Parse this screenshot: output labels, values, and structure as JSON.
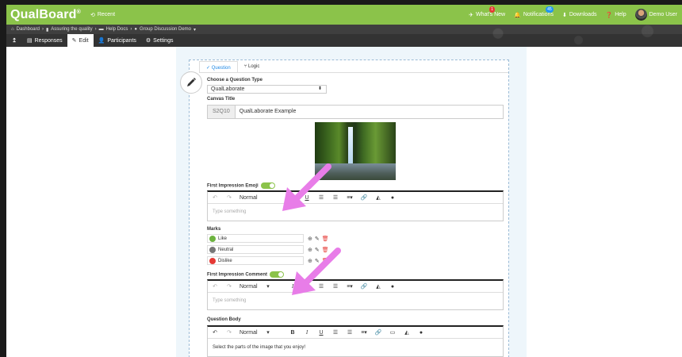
{
  "app": {
    "brand": "QualBoard",
    "brand_mark": "®",
    "recent_label": "Recent"
  },
  "topnav": {
    "whats_new": "What's New",
    "whats_new_badge": "1",
    "notifications": "Notifications",
    "notifications_badge": "45",
    "downloads": "Downloads",
    "help": "Help",
    "user": "Demo User"
  },
  "breadcrumb": [
    "Dashboard",
    "Assuring the quality",
    "Help Docs",
    "Group Discussion Demo"
  ],
  "tabs": {
    "responses": "Responses",
    "edit": "Edit",
    "participants": "Participants",
    "settings": "Settings"
  },
  "question": {
    "tabs": [
      "Question",
      "Logic"
    ],
    "type_label": "Choose a Question Type",
    "type_value": "QualLaborate",
    "canvas_title_label": "Canvas Title",
    "canvas_id": "S2Q10",
    "canvas_title_value": "QualLaborate Example",
    "emoji_label": "First Impression Emoji",
    "placeholder": "Type something",
    "format_value": "Normal",
    "marks_label": "Marks",
    "marks": [
      {
        "label": "Like",
        "color": "#6db33f"
      },
      {
        "label": "Neutral",
        "color": "#777777"
      },
      {
        "label": "Dislike",
        "color": "#e53935"
      }
    ],
    "comment_label": "First Impression Comment",
    "body_label": "Question Body",
    "body_text": "Select the parts of the image that you enjoy!"
  },
  "colors": {
    "brand_green": "#8bc34a",
    "annotation_arrow": "#e87de8"
  }
}
